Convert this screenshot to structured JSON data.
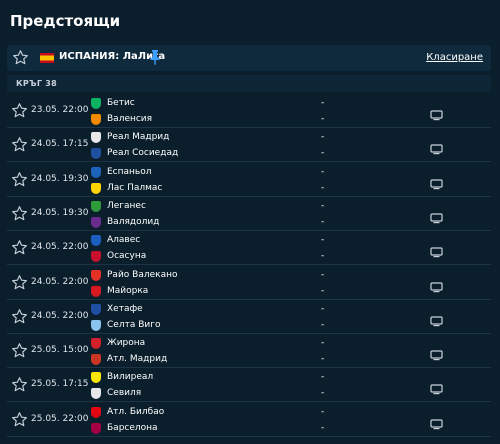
{
  "page_title": "Предстоящи",
  "league": {
    "name": "ИСПАНИЯ: ЛаЛига",
    "standings_label": "Класиране",
    "flag_colors": [
      "#c60b1e",
      "#ffc400"
    ]
  },
  "round_label": "КРЪГ 38",
  "colors": {
    "background": "#0b1e2c",
    "header_bg": "#102a3d",
    "pin": "#3aa0ff",
    "icon": "#c8d2da"
  },
  "icons": {
    "favorite": "star-outline-icon",
    "pin": "pin-icon",
    "tv": "tv-icon"
  },
  "matches": [
    {
      "time": "23.05. 22:00",
      "home": "Бетис",
      "away": "Валенсия",
      "home_score": "-",
      "away_score": "-",
      "home_color": "#0bb363",
      "away_color": "#f18a00"
    },
    {
      "time": "24.05. 17:15",
      "home": "Реал Мадрид",
      "away": "Реал Сосиедад",
      "home_score": "-",
      "away_score": "-",
      "home_color": "#e8e8e8",
      "away_color": "#1f4fa0"
    },
    {
      "time": "24.05. 19:30",
      "home": "Еспаньол",
      "away": "Лас Палмас",
      "home_score": "-",
      "away_score": "-",
      "home_color": "#1c62b9",
      "away_color": "#ffd200"
    },
    {
      "time": "24.05. 19:30",
      "home": "Леганес",
      "away": "Валядолид",
      "home_score": "-",
      "away_score": "-",
      "home_color": "#2f9b3a",
      "away_color": "#6b2c91"
    },
    {
      "time": "24.05. 22:00",
      "home": "Алавес",
      "away": "Осасуна",
      "home_score": "-",
      "away_score": "-",
      "home_color": "#1d5fbf",
      "away_color": "#c8102e"
    },
    {
      "time": "24.05. 22:00",
      "home": "Райо Валекано",
      "away": "Майорка",
      "home_score": "-",
      "away_score": "-",
      "home_color": "#e53027",
      "away_color": "#d71920"
    },
    {
      "time": "24.05. 22:00",
      "home": "Хетафе",
      "away": "Селта Виго",
      "home_score": "-",
      "away_score": "-",
      "home_color": "#1e4fa3",
      "away_color": "#8ac3ee"
    },
    {
      "time": "25.05. 15:00",
      "home": "Жирона",
      "away": "Атл. Мадрид",
      "home_score": "-",
      "away_score": "-",
      "home_color": "#d0202b",
      "away_color": "#cb3524"
    },
    {
      "time": "25.05. 17:15",
      "home": "Вилиреал",
      "away": "Севиля",
      "home_score": "-",
      "away_score": "-",
      "home_color": "#ffe600",
      "away_color": "#e8e8e8"
    },
    {
      "time": "25.05. 22:00",
      "home": "Атл. Билбао",
      "away": "Барселона",
      "home_score": "-",
      "away_score": "-",
      "home_color": "#e30613",
      "away_color": "#a50044"
    }
  ]
}
